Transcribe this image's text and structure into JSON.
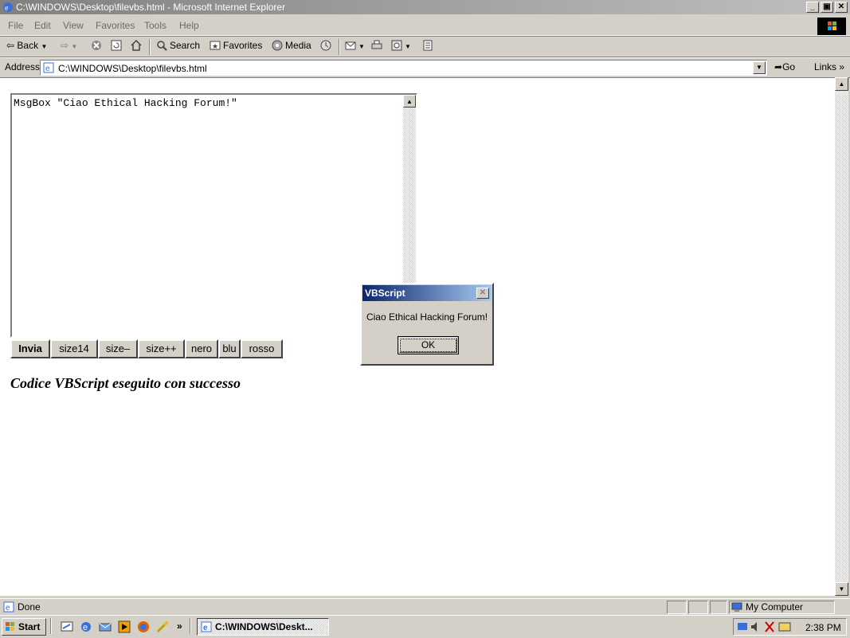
{
  "window": {
    "title": "C:\\WINDOWS\\Desktop\\filevbs.html - Microsoft Internet Explorer",
    "controls": {
      "minimize": "_",
      "maximize": "▣",
      "close": "✕"
    }
  },
  "menubar": {
    "items": [
      "File",
      "Edit",
      "View",
      "Favorites",
      "Tools",
      "Help"
    ]
  },
  "toolbar": {
    "back": "Back",
    "search": "Search",
    "favorites": "Favorites",
    "media": "Media"
  },
  "address": {
    "label": "Address",
    "value": "C:\\WINDOWS\\Desktop\\filevbs.html",
    "go": "Go",
    "links": "Links »"
  },
  "page": {
    "code": "MsgBox \"Ciao Ethical Hacking Forum!\"",
    "buttons": [
      "Invia",
      "size14",
      "size–",
      "size++",
      "nero",
      "blu",
      "rosso"
    ],
    "success_message": "Codice VBScript eseguito con successo"
  },
  "dialog": {
    "title": "VBScript",
    "message": "Ciao Ethical Hacking Forum!",
    "ok": "OK"
  },
  "statusbar": {
    "status": "Done",
    "zone": "My Computer"
  },
  "taskbar": {
    "start": "Start",
    "task": "C:\\WINDOWS\\Deskt...",
    "time": "2:38 PM",
    "chevron": "»"
  },
  "colors": {
    "title_active": "#0a246a",
    "face": "#d4d0c8"
  }
}
